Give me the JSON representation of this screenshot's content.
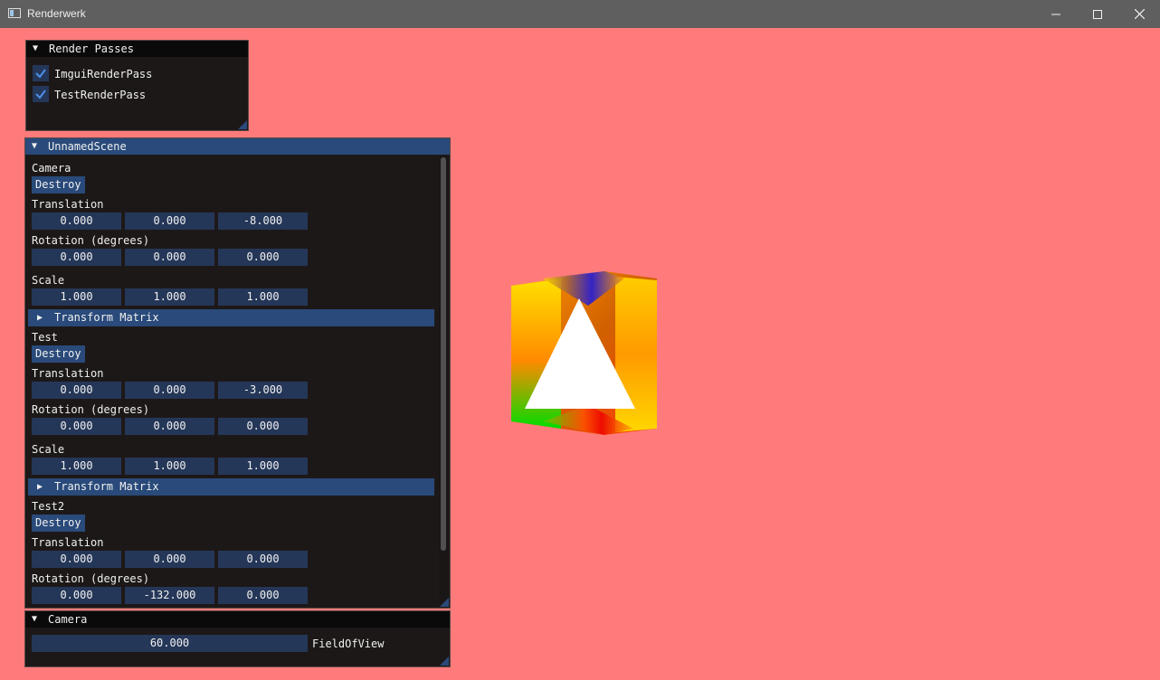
{
  "window": {
    "title": "Renderwerk"
  },
  "render_passes": {
    "title": "Render Passes",
    "items": [
      {
        "label": "ImguiRenderPass",
        "checked": true
      },
      {
        "label": "TestRenderPass",
        "checked": true
      }
    ]
  },
  "scene": {
    "title": "UnnamedScene",
    "entities": [
      {
        "name": "Camera",
        "destroy_label": "Destroy",
        "translation_label": "Translation",
        "translation": [
          "0.000",
          "0.000",
          "-8.000"
        ],
        "rotation_label": "Rotation (degrees)",
        "rotation": [
          "0.000",
          "0.000",
          "0.000"
        ],
        "scale_label": "Scale",
        "scale": [
          "1.000",
          "1.000",
          "1.000"
        ],
        "matrix_label": "Transform Matrix"
      },
      {
        "name": "Test",
        "destroy_label": "Destroy",
        "translation_label": "Translation",
        "translation": [
          "0.000",
          "0.000",
          "-3.000"
        ],
        "rotation_label": "Rotation (degrees)",
        "rotation": [
          "0.000",
          "0.000",
          "0.000"
        ],
        "scale_label": "Scale",
        "scale": [
          "1.000",
          "1.000",
          "1.000"
        ],
        "matrix_label": "Transform Matrix"
      },
      {
        "name": "Test2",
        "destroy_label": "Destroy",
        "translation_label": "Translation",
        "translation": [
          "0.000",
          "0.000",
          "0.000"
        ],
        "rotation_label": "Rotation (degrees)",
        "rotation": [
          "0.000",
          "-132.000",
          "0.000"
        ]
      }
    ]
  },
  "camera_panel": {
    "title": "Camera",
    "fov_value": "60.000",
    "fov_label": "FieldOfView"
  },
  "colors": {
    "background": "#ff7b7b",
    "panel_bg": "#1d1818",
    "accent": "#294a7a",
    "field_bg": "#253758"
  }
}
